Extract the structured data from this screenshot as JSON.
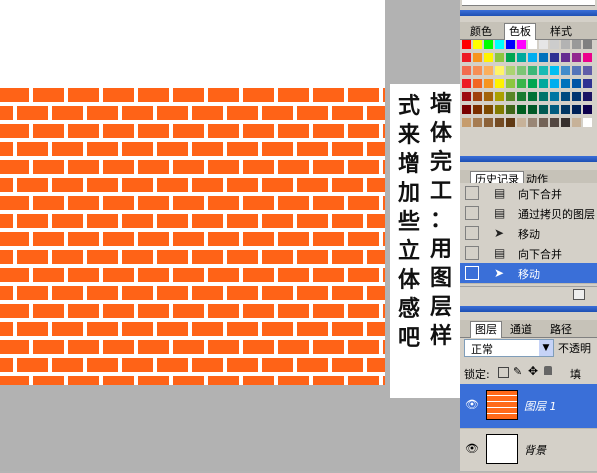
{
  "canvas": {
    "note_right_column": "墙体完工：用图层样",
    "note_left_column": "式来增加些立体感吧",
    "colors": {
      "brick": "#ff6317",
      "mortar": "#ffffff",
      "doc_white": "#ffffff",
      "workspace": "#b2b2b2"
    }
  },
  "swatches_panel": {
    "tabs": [
      {
        "label": "颜色",
        "active": false
      },
      {
        "label": "色板",
        "active": true
      },
      {
        "label": "样式",
        "active": false
      }
    ],
    "colors": [
      [
        "#ff0000",
        "#ffff00",
        "#00ff00",
        "#00ffff",
        "#0000ff",
        "#ff00ff",
        "#ffffff",
        "#e6e6e6",
        "#cccccc",
        "#b3b3b3",
        "#999999",
        "#808080"
      ],
      [
        "#ed1c24",
        "#f7941d",
        "#fff200",
        "#8dc63f",
        "#00a651",
        "#00a99d",
        "#00aeef",
        "#0072bc",
        "#2e3192",
        "#662d91",
        "#92278f",
        "#ec008c"
      ],
      [
        "#f26c4f",
        "#f68e55",
        "#fbaf5c",
        "#fff467",
        "#acd372",
        "#7cc576",
        "#3bb878",
        "#1abbb4",
        "#00bff3",
        "#438ccb",
        "#5574b9",
        "#605ca8"
      ],
      [
        "#ed1c24",
        "#f26522",
        "#f7941d",
        "#fff200",
        "#8dc63f",
        "#39b54a",
        "#00a651",
        "#00a99d",
        "#00aeef",
        "#0072bc",
        "#0054a6",
        "#2e3192"
      ],
      [
        "#9e0b0f",
        "#a0410d",
        "#a36209",
        "#aba000",
        "#598527",
        "#1a7b30",
        "#007236",
        "#00746b",
        "#0076a3",
        "#004a80",
        "#003471",
        "#1b1464"
      ],
      [
        "#790000",
        "#7b2e00",
        "#7d4900",
        "#827b00",
        "#406618",
        "#005e20",
        "#005826",
        "#005952",
        "#005b7f",
        "#003663",
        "#002157",
        "#0d004c"
      ],
      [
        "#c69c6d",
        "#a67c52",
        "#8c6239",
        "#754c24",
        "#603913",
        "#c7b299",
        "#998675",
        "#736357",
        "#534741",
        "#362f2d",
        "#c7b299",
        "#ffffff"
      ]
    ]
  },
  "history_panel": {
    "tabs": [
      {
        "label": "历史记录",
        "active": true
      },
      {
        "label": "动作",
        "active": false
      }
    ],
    "items": [
      {
        "label": "向下合并",
        "icon": "document-icon"
      },
      {
        "label": "通过拷贝的图层",
        "icon": "document-icon"
      },
      {
        "label": "移动",
        "icon": "move-tool-icon"
      },
      {
        "label": "向下合并",
        "icon": "document-icon"
      },
      {
        "label": "移动",
        "icon": "move-tool-icon",
        "selected": true
      }
    ]
  },
  "layers_panel": {
    "tabs": [
      {
        "label": "图层",
        "active": true
      },
      {
        "label": "通道",
        "active": false
      },
      {
        "label": "路径",
        "active": false
      }
    ],
    "blend_mode": "正常",
    "opacity_label": "不透明",
    "lock_label": "锁定:",
    "fill_label": "填",
    "layers": [
      {
        "name": "图层 1",
        "selected": true,
        "thumb": "brick"
      },
      {
        "name": "背景",
        "selected": false,
        "thumb": "white"
      }
    ]
  }
}
